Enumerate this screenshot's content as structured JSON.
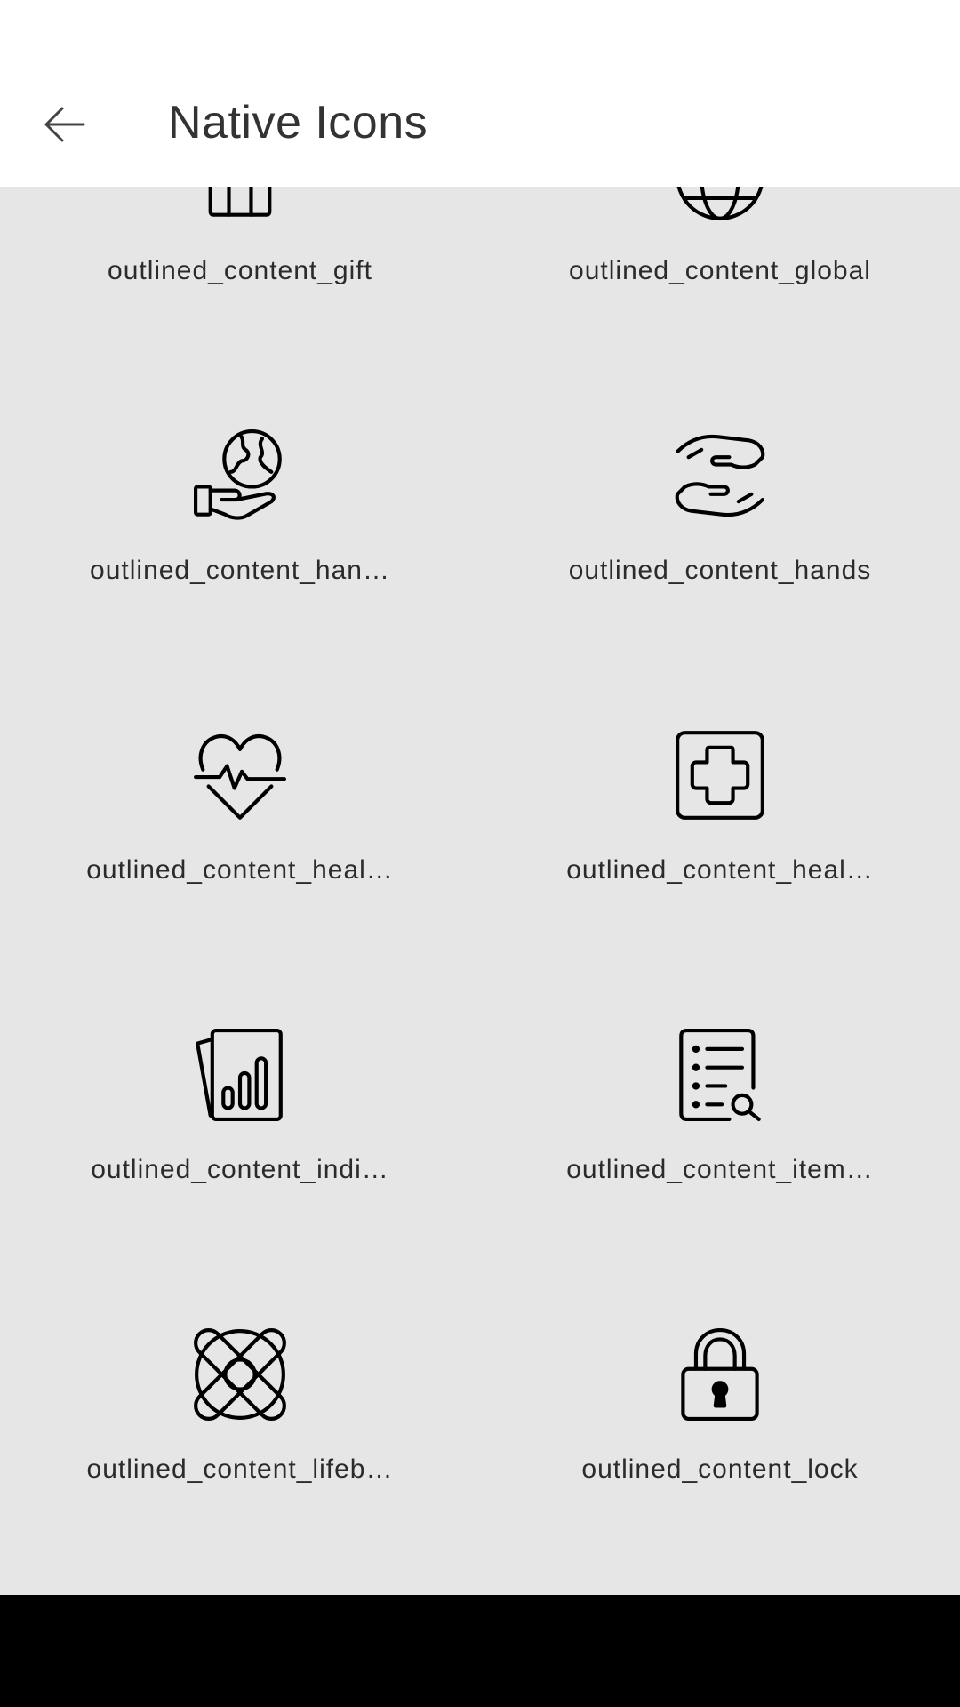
{
  "app_bar": {
    "title": "Native Icons",
    "back_icon": "arrow-left-icon"
  },
  "icons": [
    {
      "label": "outlined_content_gift",
      "icon": "gift-icon"
    },
    {
      "label": "outlined_content_global",
      "icon": "globe-icon"
    },
    {
      "label": "outlined_content_han…",
      "icon": "hand-with-globe-icon"
    },
    {
      "label": "outlined_content_hands",
      "icon": "hands-icon"
    },
    {
      "label": "outlined_content_heal…",
      "icon": "heart-pulse-icon"
    },
    {
      "label": "outlined_content_heal…",
      "icon": "medical-cross-icon"
    },
    {
      "label": "outlined_content_indi…",
      "icon": "bar-chart-document-icon"
    },
    {
      "label": "outlined_content_item…",
      "icon": "list-search-icon"
    },
    {
      "label": "outlined_content_lifeb…",
      "icon": "lifebuoy-icon"
    },
    {
      "label": "outlined_content_lock",
      "icon": "lock-icon"
    }
  ],
  "colors": {
    "app_bar_bg": "#ffffff",
    "content_bg": "#e6e6e6",
    "title_text": "#333333",
    "label_text": "#2b2b2b",
    "icon_stroke": "#000000",
    "nav_bar_bg": "#000000"
  }
}
